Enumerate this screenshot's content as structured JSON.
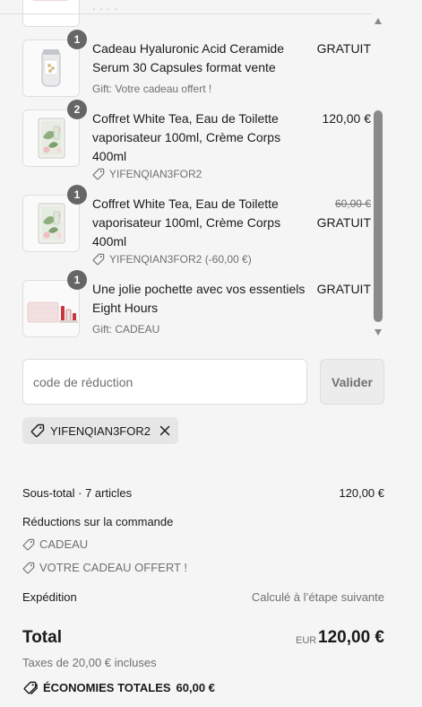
{
  "items": [
    {
      "qty": "1",
      "title": "Cadeau Hyaluronic Acid Ceramide Serum 30 Capsules format vente",
      "meta": "Gift: Votre cadeau offert !",
      "price": "GRATUIT"
    },
    {
      "qty": "2",
      "title": "Coffret White Tea, Eau de Toilette vaporisateur 100ml, Crème Corps 400ml",
      "meta": "YIFENQIAN3FOR2",
      "price": "120,00 €"
    },
    {
      "qty": "1",
      "title": "Coffret White Tea, Eau de Toilette vaporisateur 100ml, Crème Corps 400ml",
      "meta": "YIFENQIAN3FOR2 (-60,00 €)",
      "price_old": "60,00 €",
      "price": "GRATUIT"
    },
    {
      "qty": "1",
      "title": "Une jolie pochette avec vos essentiels Eight Hours",
      "meta": "Gift: CADEAU",
      "price": "GRATUIT"
    }
  ],
  "discount": {
    "placeholder": "code de réduction",
    "button": "Valider",
    "applied_code": "YIFENQIAN3FOR2"
  },
  "summary": {
    "subtotal_label": "Sous-total · 7 articles",
    "subtotal_value": "120,00 €",
    "order_discounts_label": "Réductions sur la commande",
    "order_discounts": [
      "CADEAU",
      "VOTRE CADEAU OFFERT !"
    ],
    "shipping_label": "Expédition",
    "shipping_value": "Calculé à l’étape suivante",
    "total_label": "Total",
    "currency": "EUR",
    "total_value": "120,00 €",
    "tax_text": "Taxes de 20,00 € incluses",
    "savings_label": "ÉCONOMIES TOTALES",
    "savings_value": "60,00 €"
  },
  "colors": {
    "background": "#f5f5f5",
    "badge": "#666666",
    "scrollbar": "#8a8a8a",
    "muted_text": "#707070"
  }
}
